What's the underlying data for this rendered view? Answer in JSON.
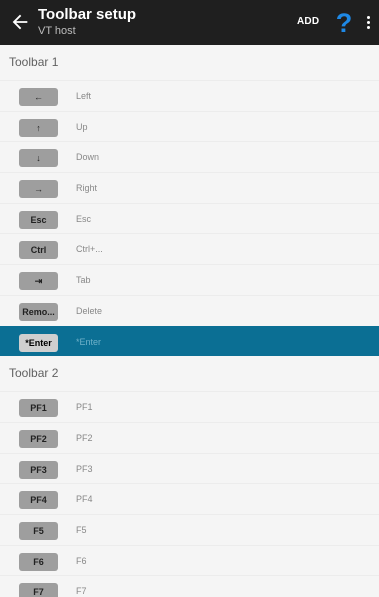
{
  "appbar": {
    "title": "Toolbar setup",
    "subtitle": "VT host",
    "add_label": "ADD",
    "help_glyph": "?",
    "help_color": "#1e88e5",
    "icons": {
      "back": "back-arrow-icon",
      "help": "help-icon",
      "more": "more-vert-icon"
    }
  },
  "toolbar1": {
    "header": "Toolbar 1",
    "items": [
      {
        "key": "←",
        "label": "Left"
      },
      {
        "key": "↑",
        "label": "Up"
      },
      {
        "key": "↓",
        "label": "Down"
      },
      {
        "key": "→",
        "label": "Right"
      },
      {
        "key": "Esc",
        "label": "Esc"
      },
      {
        "key": "Ctrl",
        "label": "Ctrl+..."
      },
      {
        "key": "⇥",
        "label": "Tab"
      },
      {
        "key": "Remo...",
        "label": "Delete"
      },
      {
        "key": "*Enter",
        "label": "*Enter",
        "selected": true
      }
    ]
  },
  "toolbar2": {
    "header": "Toolbar 2",
    "items": [
      {
        "key": "PF1",
        "label": "PF1"
      },
      {
        "key": "PF2",
        "label": "PF2"
      },
      {
        "key": "PF3",
        "label": "PF3"
      },
      {
        "key": "PF4",
        "label": "PF4"
      },
      {
        "key": "F5",
        "label": "F5"
      },
      {
        "key": "F6",
        "label": "F6"
      },
      {
        "key": "F7",
        "label": "F7"
      }
    ]
  },
  "colors": {
    "appbar_bg": "#1f1f1f",
    "selected_row_bg": "#0b6f94",
    "key_button_bg": "#9e9e9e"
  }
}
